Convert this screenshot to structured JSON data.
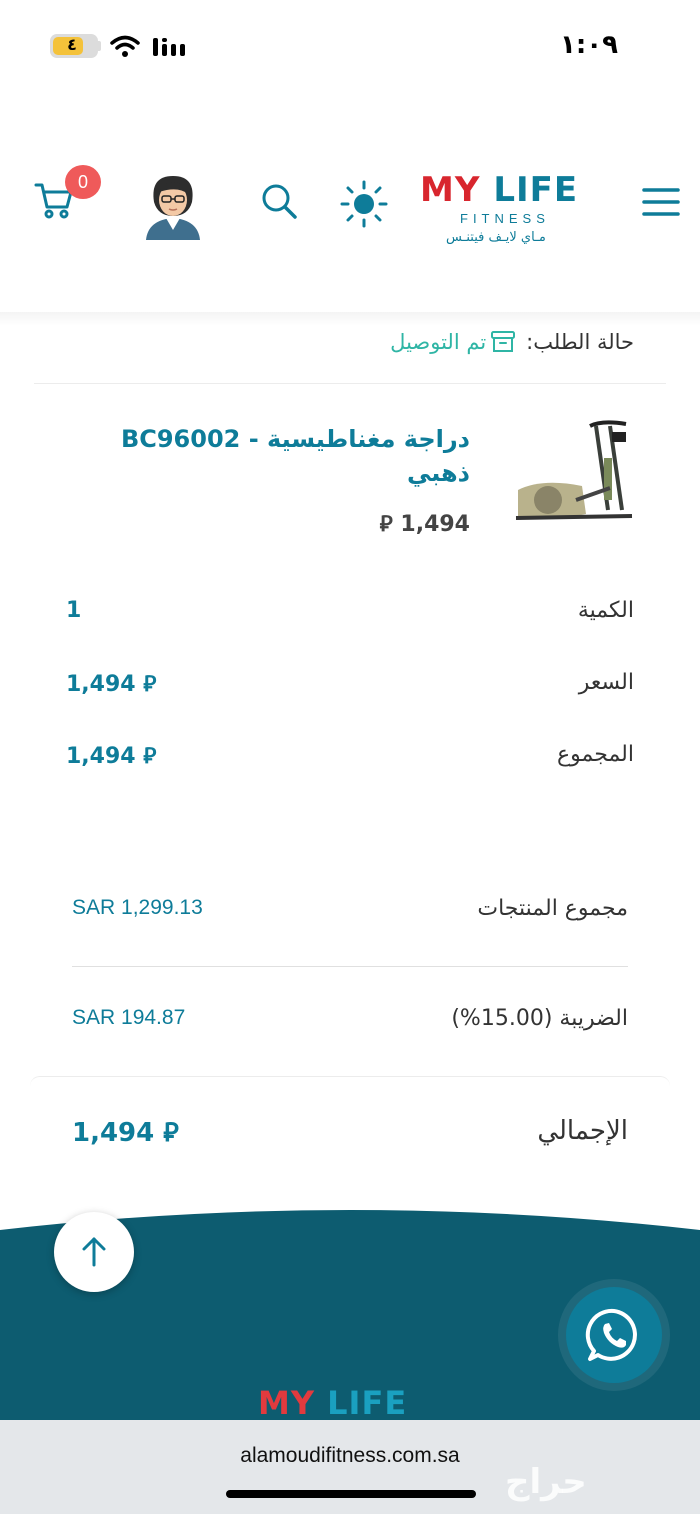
{
  "status_bar": {
    "time": "١:٠٩",
    "battery": "٤"
  },
  "header": {
    "cart_count": "0",
    "logo_main_my": "MY",
    "logo_main_life": "LIFE",
    "logo_sub": "FITNESS",
    "logo_ar": "مـاي لايـف فيتنـس"
  },
  "order": {
    "status_label": "حالة الطلب:",
    "status_value": "تم التوصيل"
  },
  "product": {
    "name": "دراجة مغناطيسية - BC96002 ذهبي",
    "price": "1,494 ⃁"
  },
  "details": [
    {
      "label": "الكمية",
      "value": "1"
    },
    {
      "label": "السعر",
      "value": "1,494 ⃁"
    },
    {
      "label": "المجموع",
      "value": "1,494 ⃁"
    }
  ],
  "summary": {
    "subtotal_label": "مجموع المنتجات",
    "subtotal_value": "SAR 1,299.13",
    "tax_label": "الضريبة (15.00%)",
    "tax_value": "SAR 194.87",
    "total_label": "الإجمالي",
    "total_value": "1,494 ⃁"
  },
  "footer": {
    "logo_my": "MY",
    "logo_life": "LIFE"
  },
  "browser": {
    "url": "alamoudifitness.com.sa",
    "watermark": "حراج"
  },
  "colors": {
    "brand_teal": "#0e7c99",
    "brand_red": "#d8262e",
    "status_green": "#2fb5a5",
    "badge": "#ef5a5a",
    "footer_bg": "#0d5c70"
  }
}
